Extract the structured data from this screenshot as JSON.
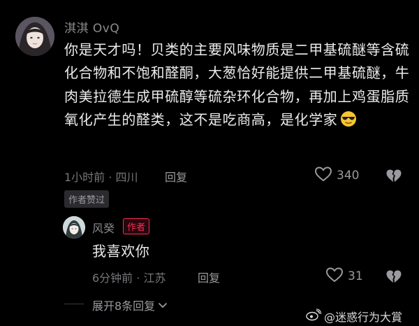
{
  "comment": {
    "username": "淇淇 OvQ",
    "text": "你是天才吗！贝类的主要风味物质是二甲基硫醚等含硫化合物和不饱和醛酮，大葱恰好能提供二甲基硫醚，牛肉美拉德生成甲硫醇等硫杂环化合物，再加上鸡蛋脂质氧化产生的醛类，这不是吃商高，是化学家",
    "emoji": "sunglasses-emoji",
    "time_location": "1小时前 · 四川",
    "reply_label": "回复",
    "like_count": "340",
    "author_liked_badge": "作者赞过"
  },
  "reply": {
    "username": "风癸",
    "role_tag": "作者",
    "text": "我喜欢你",
    "time_location": "6分钟前 · 江苏",
    "reply_label": "回复",
    "like_count": "31"
  },
  "expand": {
    "label": "展开8条回复"
  },
  "watermark": {
    "text": "@迷惑行为大賞"
  },
  "colors": {
    "background": "#000000",
    "text": "#ececec",
    "muted": "#77777c",
    "accent": "#fe2c55"
  }
}
